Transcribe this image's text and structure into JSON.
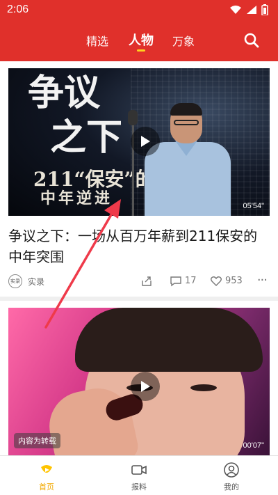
{
  "status_bar": {
    "time": "2:06"
  },
  "header": {
    "tabs": [
      {
        "label": "精选",
        "active": false
      },
      {
        "label": "人物",
        "active": true
      },
      {
        "label": "万象",
        "active": false
      }
    ],
    "accent_color": "#e0302b",
    "search_icon": "search-icon"
  },
  "feed": {
    "items": [
      {
        "thumbnail_text": {
          "line1": "争议",
          "line2": "之下",
          "line3": "211“保安”的",
          "line4": "中年逆进"
        },
        "duration": "05'54\"",
        "title": "争议之下：一场从百万年薪到211保安的中年突围",
        "author": "实录",
        "author_avatar_text": "实录",
        "comments": "17",
        "likes": "953"
      },
      {
        "badge": "内容为转载",
        "duration": "00'07\""
      }
    ]
  },
  "bottom_nav": {
    "items": [
      {
        "label": "首页",
        "icon": "home-icon",
        "active": true
      },
      {
        "label": "报料",
        "icon": "video-camera-icon",
        "active": false
      },
      {
        "label": "我的",
        "icon": "profile-icon",
        "active": false
      }
    ],
    "active_color": "#f2a900"
  }
}
